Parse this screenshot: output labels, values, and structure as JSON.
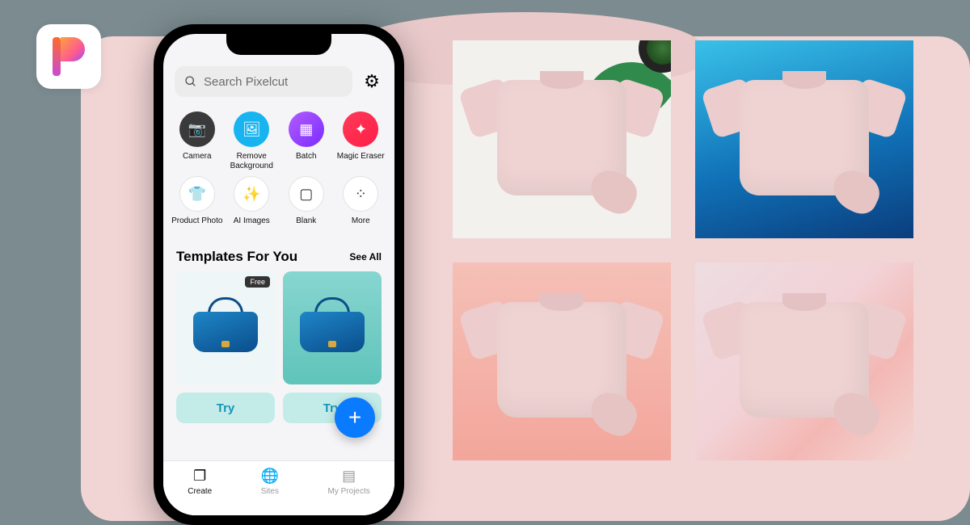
{
  "app": {
    "name": "Pixelcut"
  },
  "search": {
    "placeholder": "Search Pixelcut"
  },
  "tools": [
    {
      "label": "Camera",
      "icon": "camera-icon",
      "style": "camera"
    },
    {
      "label": "Remove Background",
      "icon": "image-icon",
      "style": "removebg"
    },
    {
      "label": "Batch",
      "icon": "grid-icon",
      "style": "batch"
    },
    {
      "label": "Magic Eraser",
      "icon": "eraser-icon",
      "style": "eraser"
    },
    {
      "label": "Product Photo",
      "icon": "tshirt-icon",
      "style": "outline"
    },
    {
      "label": "AI Images",
      "icon": "sparkle-icon",
      "style": "outline"
    },
    {
      "label": "Blank",
      "icon": "square-icon",
      "style": "outline"
    },
    {
      "label": "More",
      "icon": "more-icon",
      "style": "outline"
    }
  ],
  "templates": {
    "title": "Templates For You",
    "see_all": "See All",
    "cards": [
      {
        "badge": "Free",
        "try_label": "Try"
      },
      {
        "badge": "",
        "try_label": "Try"
      }
    ]
  },
  "tabs": [
    {
      "label": "Create",
      "icon": "create-icon",
      "active": true
    },
    {
      "label": "Sites",
      "icon": "globe-icon",
      "active": false
    },
    {
      "label": "My Projects",
      "icon": "projects-icon",
      "active": false
    }
  ],
  "previews": [
    "White with plants",
    "Blue gradient",
    "Coral gradient",
    "Pink marble"
  ]
}
